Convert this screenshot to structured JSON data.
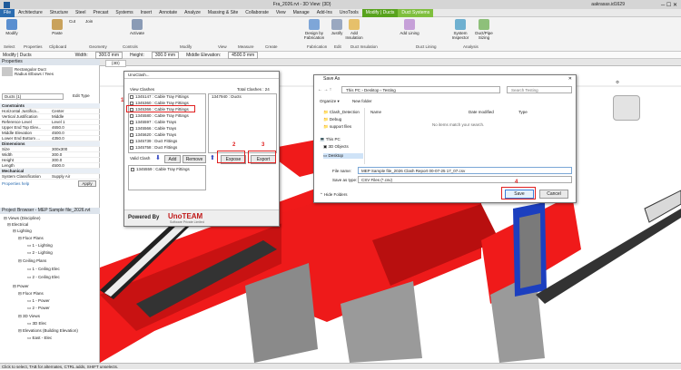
{
  "window": {
    "title": "Fra_2026.rvt - 3D View: {3D}",
    "user": "aakrasas.id1629"
  },
  "ribbon_tabs": [
    "File",
    "Architecture",
    "Structure",
    "Steel",
    "Precast",
    "Systems",
    "Insert",
    "Annotate",
    "Analyze",
    "Massing & Site",
    "Collaborate",
    "View",
    "Manage",
    "Add-Ins",
    "UnoTools",
    "Modify | Ducts",
    "Duct Systems"
  ],
  "ribbon_buttons": [
    "Modify",
    "Paste",
    "Cut",
    "Join",
    "Activate",
    "Design by Fabrication",
    "Justify",
    "Add Insulation",
    "Add Lining",
    "System Inspector",
    "Duct/Pipe Sizing"
  ],
  "ribbon_panels": [
    "Select",
    "Properties",
    "Clipboard",
    "Geometry",
    "Controls",
    "Modify",
    "View",
    "Measure",
    "Create",
    "Fabrication",
    "Edit",
    "Duct Insulation",
    "Duct Lining",
    "Analysis"
  ],
  "options_bar": {
    "context": "Modify | Ducts",
    "width_label": "Width:",
    "width_value": "300.0 mm",
    "height_label": "Height:",
    "height_value": "300.0 mm",
    "offset_label": "Middle Elevation:",
    "offset_value": "4500.0 mm"
  },
  "properties": {
    "header": "Properties",
    "type_name": "Rectangular Duct",
    "type_sub": "Radius Elbows / Tees",
    "selector": "Ducts (1)",
    "edit_type": "Edit Type",
    "sections": [
      "Constraints",
      "Dimensions",
      "Mechanical"
    ],
    "constraints": [
      [
        "Horizontal Justifica...",
        "Center"
      ],
      [
        "Vertical Justification",
        "Middle"
      ],
      [
        "Reference Level",
        "Level 1"
      ],
      [
        "Upper End Top Elev...",
        "4650.0"
      ],
      [
        "Middle Elevation",
        "4500.0"
      ],
      [
        "Lower End Bottom ...",
        "4350.0"
      ]
    ],
    "dimensions": [
      [
        "Size",
        "300x300"
      ],
      [
        "Width",
        "300.0"
      ],
      [
        "Height",
        "300.0"
      ],
      [
        "Length",
        "4500.0"
      ]
    ],
    "mechanical": [
      [
        "System Classification",
        "Supply Air"
      ]
    ],
    "help": "Properties help",
    "apply": "Apply"
  },
  "project_browser": {
    "title": "Project Browser - MEP Sample file_2026.rvt",
    "items": [
      "Views (Discipline)",
      "Electrical",
      "Lighting",
      "Floor Plans",
      "1 - Lighting",
      "2 - Lighting",
      "Ceiling Plans",
      "1 - Ceiling Elec",
      "2 - Ceiling Elec",
      "Power",
      "Floor Plans",
      "1 - Power",
      "2 - Power",
      "3D Views",
      "3D Elec",
      "Elevations (Building Elevation)",
      "East - Elec"
    ]
  },
  "view_tab": "{3D}",
  "status_bar": "Click to select, TAB for alternates, CTRL adds, SHIFT unselects.",
  "clash_dialog": {
    "title": "UnoClash...",
    "view_label": "View Clashes",
    "total": "Total Clashes : 24",
    "rows": [
      "1345147 : Cable Tray Fittings",
      "1345360 : Cable Tray Fittings",
      "1345366 : Cable Tray Fittings",
      "1345580 : Cable Tray Fittings",
      "1345597 : Cable Trays",
      "1345566 : Cable Trays",
      "1345620 : Cable Trays",
      "1345739 : Duct Fittings",
      "1345758 : Duct Fittings"
    ],
    "right_rows": [
      "1347940 : Ducts"
    ],
    "valid_label": "Valid Clash",
    "valid_row": "1345559 : Cable Tray Fittings",
    "add": "Add",
    "remove": "Remove",
    "expose": "Expose",
    "export": "Export",
    "powered": "Powered By",
    "brand": "UnoTEAM",
    "brand_sub": "Software Private Limited"
  },
  "save_dialog": {
    "title": "Save As",
    "path": [
      "This PC",
      "Desktop",
      "Testing"
    ],
    "search": "Search Testing",
    "organize": "Organize ▾",
    "new_folder": "New folder",
    "col_name": "Name",
    "col_date": "Date modified",
    "col_type": "Type",
    "empty": "No items match your search.",
    "nav": [
      "Clash_Detection",
      "Debug",
      "support files",
      "This PC",
      "3D Objects",
      "Desktop"
    ],
    "filename_label": "File name:",
    "filename": "MEP Sample file_2026 Clash Report 00-07-25 17_07.csv",
    "type_label": "Save as type:",
    "type": "CSV Files (*.csv)",
    "hide": "Hide Folders",
    "save": "Save",
    "cancel": "Cancel"
  },
  "annotations": [
    "1",
    "2",
    "3",
    "4"
  ],
  "colors": {
    "red": "#e02020",
    "accent": "#2b6cb0",
    "ctx": "#58a31d"
  }
}
